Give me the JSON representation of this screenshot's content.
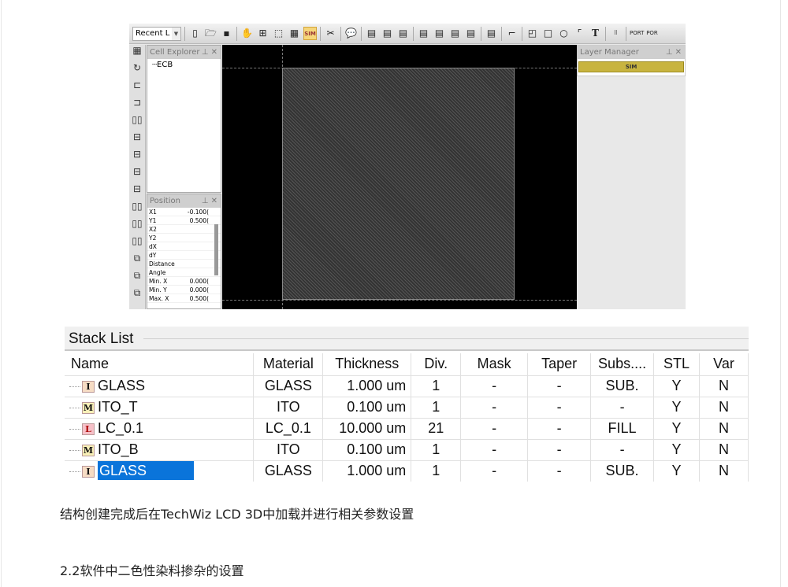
{
  "app": {
    "recent_combo": "Recent L",
    "toolbar_icons": [
      "new-file-icon",
      "open-folder-icon",
      "save-icon",
      "hand-pan-icon",
      "zoom-fit-icon",
      "select-icon",
      "grid-icon",
      "sim-icon",
      "tools-icon",
      "help-icon",
      "report-icon",
      "zoom-view-icon",
      "window-icon",
      "window2-icon",
      "window3-icon",
      "window4-icon",
      "window5-icon",
      "polyline-icon",
      "polygon-icon",
      "rectangle-icon",
      "circle-icon",
      "arc-icon",
      "text-icon",
      "array-icon",
      "port-icon",
      "port2-icon"
    ],
    "sim_button": "SIM",
    "text_tool": "T",
    "cell_explorer": {
      "title": "Cell Explorer",
      "items": [
        "ECB"
      ]
    },
    "position": {
      "title": "Position",
      "rows": [
        {
          "label": "X1",
          "value": "-0.100("
        },
        {
          "label": "Y1",
          "value": "0.500("
        },
        {
          "label": "X2",
          "value": ""
        },
        {
          "label": "Y2",
          "value": ""
        },
        {
          "label": "dX",
          "value": ""
        },
        {
          "label": "dY",
          "value": ""
        },
        {
          "label": "Distance",
          "value": ""
        },
        {
          "label": "Angle",
          "value": ""
        },
        {
          "label": "Min. X",
          "value": "0.000("
        },
        {
          "label": "Min. Y",
          "value": "0.000("
        },
        {
          "label": "Max. X",
          "value": "0.500("
        }
      ]
    },
    "layer_manager": {
      "title": "Layer Manager",
      "layers": [
        "SIM"
      ]
    }
  },
  "stack_list": {
    "title": "Stack List",
    "columns": [
      "Name",
      "Material",
      "Thickness",
      "Div.",
      "Mask",
      "Taper",
      "Subs....",
      "STL",
      "Var"
    ],
    "rows": [
      {
        "type": "I",
        "name": "GLASS",
        "material": "GLASS",
        "thickness": "1.000 um",
        "div": "1",
        "mask": "-",
        "taper": "-",
        "subs": "SUB.",
        "stl": "Y",
        "var": "N"
      },
      {
        "type": "M",
        "name": "ITO_T",
        "material": "ITO",
        "thickness": "0.100 um",
        "div": "1",
        "mask": "-",
        "taper": "-",
        "subs": "-",
        "stl": "Y",
        "var": "N"
      },
      {
        "type": "L",
        "name": "LC_0.1",
        "material": "LC_0.1",
        "thickness": "10.000 um",
        "div": "21",
        "mask": "-",
        "taper": "-",
        "subs": "FILL",
        "stl": "Y",
        "var": "N"
      },
      {
        "type": "M",
        "name": "ITO_B",
        "material": "ITO",
        "thickness": "0.100 um",
        "div": "1",
        "mask": "-",
        "taper": "-",
        "subs": "-",
        "stl": "Y",
        "var": "N"
      },
      {
        "type": "I",
        "name": "GLASS",
        "material": "GLASS",
        "thickness": "1.000 um",
        "div": "1",
        "mask": "-",
        "taper": "-",
        "subs": "SUB.",
        "stl": "Y",
        "var": "N",
        "selected": true
      }
    ]
  },
  "paragraphs": [
    "结构创建完成后在TechWiz LCD 3D中加载并进行相关参数设置",
    "2.2软件中二色性染料掺杂的设置"
  ],
  "colors": {
    "selection": "#0a74da",
    "sim_layer": "#c8b440"
  }
}
